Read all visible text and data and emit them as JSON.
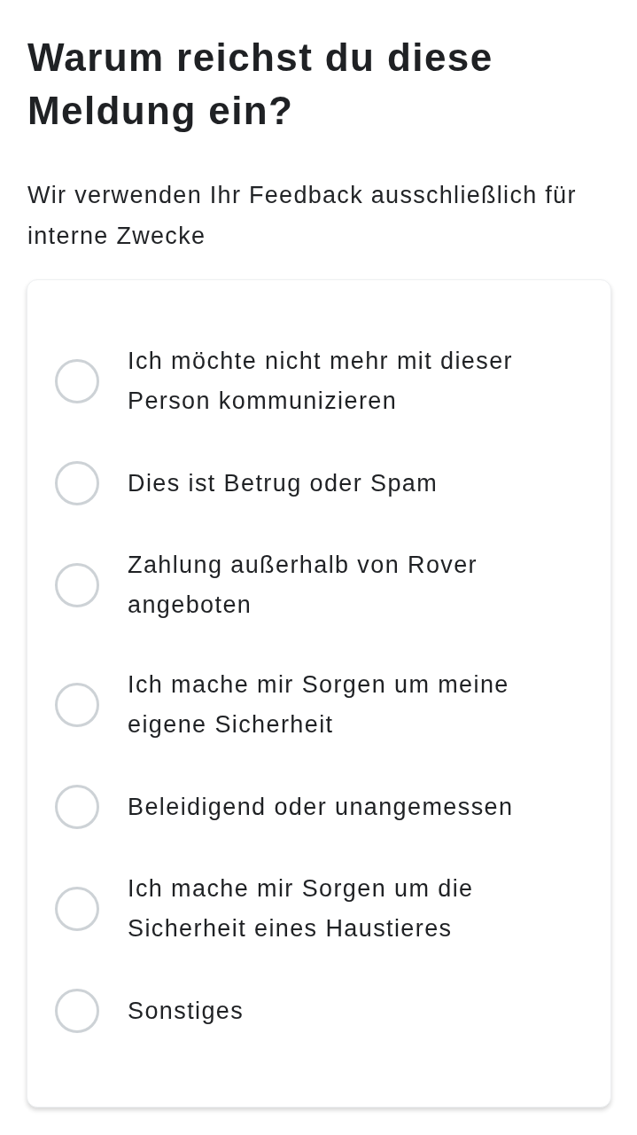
{
  "title": "Warum reichst du diese Meldung ein?",
  "subtitle": "Wir verwenden Ihr Feedback ausschließlich für interne Zwecke",
  "options": [
    {
      "label": "Ich möchte nicht mehr mit dieser Person kommunizieren",
      "selected": false
    },
    {
      "label": "Dies ist Betrug oder Spam",
      "selected": false
    },
    {
      "label": "Zahlung außerhalb von Rover angeboten",
      "selected": false
    },
    {
      "label": "Ich mache mir Sorgen um meine eigene Sicherheit",
      "selected": false
    },
    {
      "label": "Beleidigend oder unangemessen",
      "selected": false
    },
    {
      "label": "Ich mache mir Sorgen um die Sicherheit eines Haustieres",
      "selected": false
    },
    {
      "label": "Sonstiges",
      "selected": false
    }
  ]
}
